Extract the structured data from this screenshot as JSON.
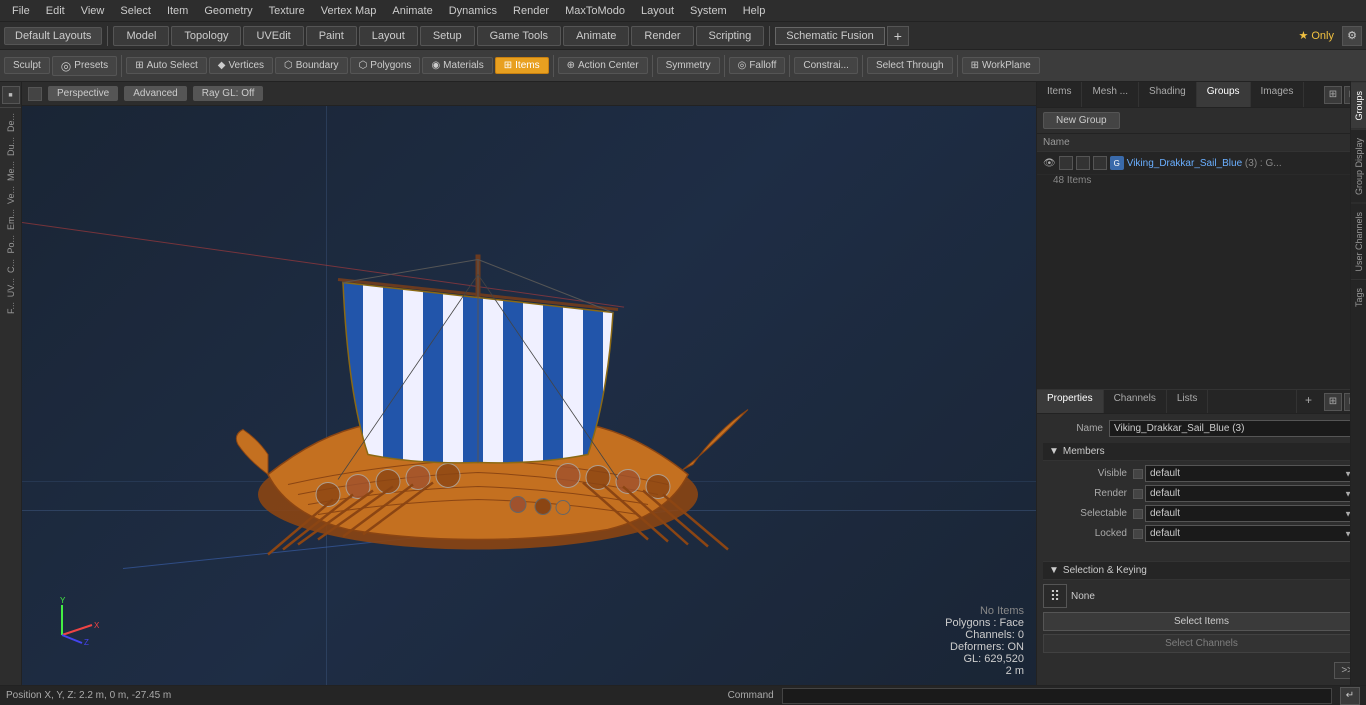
{
  "menubar": {
    "items": [
      "File",
      "Edit",
      "View",
      "Select",
      "Item",
      "Geometry",
      "Texture",
      "Vertex Map",
      "Animate",
      "Dynamics",
      "Render",
      "MaxToModo",
      "Layout",
      "System",
      "Help"
    ]
  },
  "layoutbar": {
    "default_label": "Default Layouts",
    "tabs": [
      "Model",
      "Topology",
      "UVEdit",
      "Paint",
      "Layout",
      "Setup",
      "Game Tools",
      "Animate",
      "Render",
      "Scripting"
    ],
    "schematic_fusion": "Schematic Fusion",
    "only_label": "★ Only",
    "plus_label": "+"
  },
  "toolbar": {
    "sculpt": "Sculpt",
    "presets": "Presets",
    "auto_select": "Auto Select",
    "vertices": "Vertices",
    "boundary": "Boundary",
    "polygons": "Polygons",
    "materials": "Materials",
    "items": "Items",
    "action_center": "Action Center",
    "symmetry": "Symmetry",
    "falloff": "Falloff",
    "constraints": "Constrai...",
    "select_through": "Select Through",
    "work_plane": "WorkPlane"
  },
  "viewport": {
    "mode": "Perspective",
    "advanced": "Advanced",
    "ray_gl": "Ray GL: Off",
    "info": {
      "no_items": "No Items",
      "polygons": "Polygons : Face",
      "channels": "Channels: 0",
      "deformers": "Deformers: ON",
      "gl": "GL: 629,520",
      "scale": "2 m"
    },
    "coords": "Position X, Y, Z:  2.2 m, 0 m, -27.45 m"
  },
  "groups_panel": {
    "tabs": [
      "Items",
      "Mesh ...",
      "Shading",
      "Groups",
      "Images"
    ],
    "new_group_btn": "New Group",
    "columns": [
      "Name"
    ],
    "group_item": {
      "name": "Viking_Drakkar_Sail_Blue",
      "count_label": "(3) : G...",
      "count_detail": "48 Items"
    }
  },
  "properties_panel": {
    "tabs": [
      "Properties",
      "Channels",
      "Lists"
    ],
    "plus": "+",
    "name_label": "Name",
    "name_value": "Viking_Drakkar_Sail_Blue (3)",
    "members_section": "Members",
    "props": [
      {
        "label": "Visible",
        "value": "default"
      },
      {
        "label": "Render",
        "value": "default"
      },
      {
        "label": "Selectable",
        "value": "default"
      },
      {
        "label": "Locked",
        "value": "default"
      }
    ],
    "sel_keying_section": "Selection & Keying",
    "none_label": "None",
    "select_items_btn": "Select Items",
    "select_channels_btn": "Select Channels",
    "arrow_btn": ">>"
  },
  "vertical_tabs": {
    "items": [
      "Groups",
      "Group Display",
      "User Channels",
      "Tags"
    ]
  },
  "statusbar": {
    "coords": "Position X, Y, Z:  2.2 m, 0 m, -27.45 m",
    "command_label": "Command",
    "command_placeholder": ""
  }
}
